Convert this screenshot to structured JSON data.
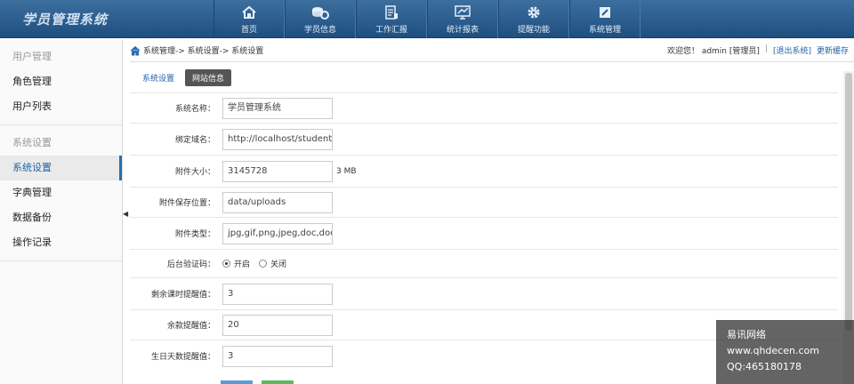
{
  "app": {
    "title": "学员管理系统"
  },
  "nav": [
    {
      "label": "首页",
      "icon": "home-icon"
    },
    {
      "label": "学员信息",
      "icon": "coins-gear-icon"
    },
    {
      "label": "工作汇报",
      "icon": "report-icon"
    },
    {
      "label": "统计报表",
      "icon": "monitor-chart-icon"
    },
    {
      "label": "提醒功能",
      "icon": "gear-icon"
    },
    {
      "label": "系统管理",
      "icon": "edit-icon"
    }
  ],
  "sidebar": {
    "groups": [
      {
        "heading": "用户管理",
        "items": [
          "角色管理",
          "用户列表"
        ]
      },
      {
        "heading": "系统设置",
        "items": [
          "系统设置",
          "字典管理",
          "数据备份",
          "操作记录"
        ]
      }
    ],
    "active_item": "系统设置"
  },
  "breadcrumb": "系统管理-> 系统设置-> 系统设置",
  "userbar": {
    "welcome": "欢迎您！ admin [管理员]",
    "separator": "|",
    "logout": "[退出系统]",
    "refresh_cache": "更新缓存"
  },
  "tabs": {
    "system_settings": "系统设置",
    "site_info": "网站信息"
  },
  "form": {
    "site_name": {
      "label": "系统名称：",
      "value": "学员管理系统"
    },
    "domain": {
      "label": "绑定域名：",
      "value": "http://localhost/student/"
    },
    "attachment_size": {
      "label": "附件大小：",
      "value": "3145728",
      "unit": "3 MB"
    },
    "attachment_path": {
      "label": "附件保存位置：",
      "value": "data/uploads"
    },
    "attachment_types": {
      "label": "附件类型：",
      "value": "jpg,gif,png,jpeg,doc,docx,x"
    },
    "captcha": {
      "label": "后台验证码：",
      "on": "开启",
      "off": "关闭",
      "selected": "开启"
    },
    "remaining_lessons": {
      "label": "剩余课时提醒值：",
      "value": "3"
    },
    "balance": {
      "label": "余款提醒值：",
      "value": "20"
    },
    "birthday_days": {
      "label": "生日天数提醒值：",
      "value": "3"
    }
  },
  "watermark": {
    "line1": "易讯网络",
    "line2": "www.qhdecen.com",
    "line3": "QQ:465180178"
  },
  "colors": {
    "header": "#2a5d8f",
    "accent": "#1f63a8",
    "tab_button": "#555555"
  }
}
